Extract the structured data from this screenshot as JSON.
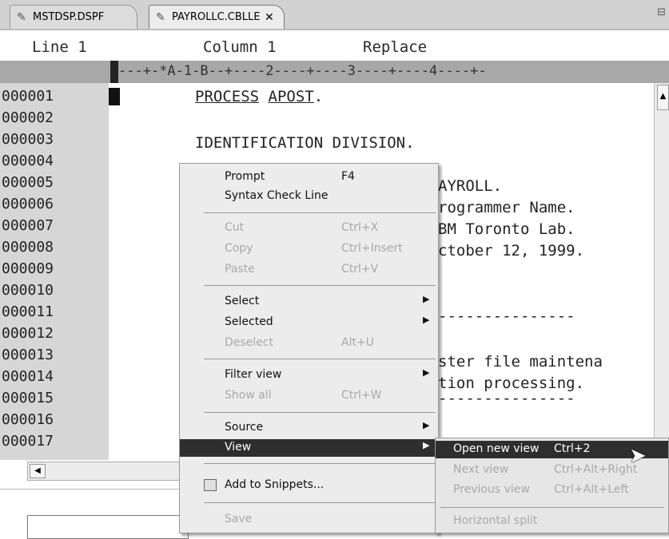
{
  "tabs": [
    {
      "label": "MSTDSP.DSPF",
      "active": false
    },
    {
      "label": "PAYROLLC.CBLLE",
      "active": true,
      "close": "✕"
    }
  ],
  "status": {
    "line": "Line 1",
    "column": "Column 1",
    "mode": "Replace"
  },
  "ruler": "---+-*A-1-B--+----2----+----3----+----4----+-",
  "line_numbers": [
    "000001",
    "000002",
    "000003",
    "000004",
    "000005",
    "000006",
    "000007",
    "000008",
    "000009",
    "000010",
    "000011",
    "000012",
    "000013",
    "000014",
    "000015",
    "000016",
    "000017"
  ],
  "code": {
    "l1a": "PROCESS",
    "l1b": "APOST",
    "l1c": ".",
    "l3": "IDENTIFICATION DIVISION.",
    "l5": "AYROLL.",
    "l6": "rogrammer Name.",
    "l7": "BM Toronto Lab.",
    "l8": "ctober 12, 1999.",
    "l11": "---------------",
    "l13": "ster file maintena",
    "l14": "tion processing.",
    "l15": "---------------"
  },
  "context_menu": [
    {
      "label": "Prompt",
      "shortcut": "F4",
      "enabled": true
    },
    {
      "label": "Syntax Check Line",
      "shortcut": "",
      "enabled": true
    },
    {
      "label": "Cut",
      "shortcut": "Ctrl+X",
      "enabled": false
    },
    {
      "label": "Copy",
      "shortcut": "Ctrl+Insert",
      "enabled": false
    },
    {
      "label": "Paste",
      "shortcut": "Ctrl+V",
      "enabled": false
    },
    {
      "label": "Select",
      "shortcut": "",
      "enabled": true,
      "submenu": true
    },
    {
      "label": "Selected",
      "shortcut": "",
      "enabled": true,
      "submenu": true
    },
    {
      "label": "Deselect",
      "shortcut": "Alt+U",
      "enabled": false
    },
    {
      "label": "Filter view",
      "shortcut": "",
      "enabled": true,
      "submenu": true
    },
    {
      "label": "Show all",
      "shortcut": "Ctrl+W",
      "enabled": false
    },
    {
      "label": "Source",
      "shortcut": "",
      "enabled": true,
      "submenu": true
    },
    {
      "label": "View",
      "shortcut": "",
      "enabled": true,
      "submenu": true,
      "highlighted": true
    },
    {
      "label": "Add to Snippets...",
      "shortcut": "",
      "enabled": true
    },
    {
      "label": "Save",
      "shortcut": "",
      "enabled": false
    }
  ],
  "view_submenu": [
    {
      "label": "Open new view",
      "shortcut": "Ctrl+2",
      "enabled": true,
      "highlighted": true
    },
    {
      "label": "Next view",
      "shortcut": "Ctrl+Alt+Right",
      "enabled": false
    },
    {
      "label": "Previous view",
      "shortcut": "Ctrl+Alt+Left",
      "enabled": false
    },
    {
      "label": "Horizontal split",
      "shortcut": "",
      "enabled": false
    }
  ],
  "colors": {
    "highlight": "#2e2e2e",
    "gutter": "#d6d6d6",
    "ruler": "#a8a8a8",
    "disabled_text": "#a8a8a8"
  },
  "icons": {
    "tab_file": "pencil-file-icon",
    "snippets": "snippet-icon",
    "submenu": "triangle-right-icon"
  }
}
